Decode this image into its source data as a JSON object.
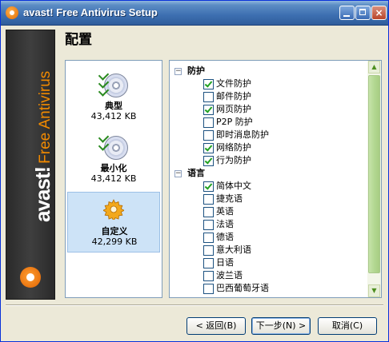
{
  "window": {
    "title": "avast! Free Antivirus Setup",
    "close_glyph": "×"
  },
  "brand": {
    "name": "avast!",
    "tagline": "Free Antivirus"
  },
  "page": {
    "title": "配置"
  },
  "setup_options": [
    {
      "name": "典型",
      "size": "43,412 KB",
      "icon": "cd-checklist-icon",
      "selected": false
    },
    {
      "name": "最小化",
      "size": "43,412 KB",
      "icon": "cd-checklist-icon",
      "selected": false
    },
    {
      "name": "自定义",
      "size": "42,299 KB",
      "icon": "gear-icon",
      "selected": true
    }
  ],
  "tree": {
    "groups": [
      {
        "label": "防护",
        "expander": "−",
        "items": [
          {
            "label": "文件防护",
            "checked": true
          },
          {
            "label": "邮件防护",
            "checked": false
          },
          {
            "label": "网页防护",
            "checked": true
          },
          {
            "label": "P2P 防护",
            "checked": false
          },
          {
            "label": "即时消息防护",
            "checked": false
          },
          {
            "label": "网络防护",
            "checked": true
          },
          {
            "label": "行为防护",
            "checked": true
          }
        ]
      },
      {
        "label": "语言",
        "expander": "−",
        "items": [
          {
            "label": "简体中文",
            "checked": true
          },
          {
            "label": "捷克语",
            "checked": false
          },
          {
            "label": "英语",
            "checked": false
          },
          {
            "label": "法语",
            "checked": false
          },
          {
            "label": "德语",
            "checked": false
          },
          {
            "label": "意大利语",
            "checked": false
          },
          {
            "label": "日语",
            "checked": false
          },
          {
            "label": "波兰语",
            "checked": false
          },
          {
            "label": "巴西葡萄牙语",
            "checked": false
          }
        ]
      }
    ],
    "scroll_up": "▲",
    "scroll_down": "▼"
  },
  "buttons": {
    "back": "< 返回(B)",
    "next": "下一步(N) >",
    "cancel": "取消(C)"
  },
  "colors": {
    "accent_orange": "#f28a00",
    "check_green": "#21a121",
    "selection_blue": "#cde3f7"
  }
}
